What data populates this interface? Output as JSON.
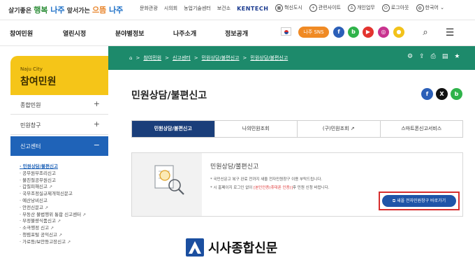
{
  "topbar": {
    "slogan": {
      "pre": "살기좋은 ",
      "happy": "행복",
      "naju1": " 나주",
      "mid": " 앞서가는 ",
      "best": "으뜸",
      "naju2": " 나주"
    },
    "links": [
      "문화관광",
      "시의회",
      "농업기술센터",
      "보건소"
    ],
    "kentech": "KENTECH",
    "right_links": [
      "혁신도시",
      "관련사이트",
      "개인업무",
      "로그아웃",
      "한국어"
    ]
  },
  "nav": {
    "items": [
      "참여민원",
      "열린시정",
      "분야별정보",
      "나주소개",
      "정보공개"
    ],
    "sns_label": "나주 SNS",
    "sns_icons": [
      {
        "glyph": "f",
        "color": "#2b5fb8"
      },
      {
        "glyph": "b",
        "color": "#2fb34a"
      },
      {
        "glyph": "▶",
        "color": "#e3342f"
      },
      {
        "glyph": "◎",
        "color": "#c8338f"
      },
      {
        "glyph": "●",
        "color": "#f2c21a"
      }
    ],
    "search_icon": "⌕",
    "menu_icon": "☰"
  },
  "breadcrumb": {
    "home_icon": "⌂",
    "items": [
      "참여민원",
      "신고센터",
      "민원상담/불편신고",
      "민원상담/불편신고"
    ],
    "separator": ">",
    "tools": [
      "⚙",
      "⇪",
      "⎙",
      "▤",
      "★"
    ]
  },
  "sidebar": {
    "city": "Naju City",
    "title": "참여민원",
    "items": [
      {
        "label": "종합민원",
        "toggle": "+"
      },
      {
        "label": "민원창구",
        "toggle": "+"
      },
      {
        "label": "신고센터",
        "toggle": "−"
      }
    ],
    "sub_items": [
      {
        "label": "· 민원상담/불편신고",
        "ext": ""
      },
      {
        "label": "· 공무원부조리신고",
        "ext": ""
      },
      {
        "label": "· 불친절공무원신고",
        "ext": ""
      },
      {
        "label": "· 갑질피해신고",
        "ext": "↗"
      },
      {
        "label": "· 국무조정실규제개혁신문고",
        "ext": ""
      },
      {
        "label": "· 예산낭비신고",
        "ext": ""
      },
      {
        "label": "· 안전신문고",
        "ext": "↗"
      },
      {
        "label": "· 부동산 불법행위 통합 신고센터",
        "ext": "↗"
      },
      {
        "label": "· 부정불량식품신고",
        "ext": "↗"
      },
      {
        "label": "· 소극행정 신고",
        "ext": "↗"
      },
      {
        "label": "· 청렴포털 공익신고",
        "ext": "↗"
      },
      {
        "label": "· 가로등/보안등고장신고",
        "ext": "↗"
      }
    ]
  },
  "content": {
    "title": "민원상담/불편신고",
    "share": [
      {
        "glyph": "f",
        "color": "#2b5fb8"
      },
      {
        "glyph": "X",
        "color": "#111111"
      },
      {
        "glyph": "b",
        "color": "#2fb34a"
      }
    ],
    "tabs": [
      {
        "label": "민원상담/불편신고",
        "ext": ""
      },
      {
        "label": "나의민원조회",
        "ext": ""
      },
      {
        "label": "(구)민원조회",
        "ext": "↗"
      },
      {
        "label": "스마트폰신고서비스",
        "ext": ""
      }
    ],
    "panel": {
      "heading": "민원상담/불편신고",
      "note1": "* 국민신문고 복구 완료 전까지 새올 전자민원창구 이용 부탁드립니다.",
      "note2_pre": "* 시 홈페이지 로그인 없이 ",
      "note2_red": "[본인인증(휴대폰 인증)]",
      "note2_post": "후 민원 신청 바랍니다.",
      "button": "새올 전자민원창구 바로가기"
    }
  },
  "watermark": {
    "text": "시사종합신문"
  }
}
